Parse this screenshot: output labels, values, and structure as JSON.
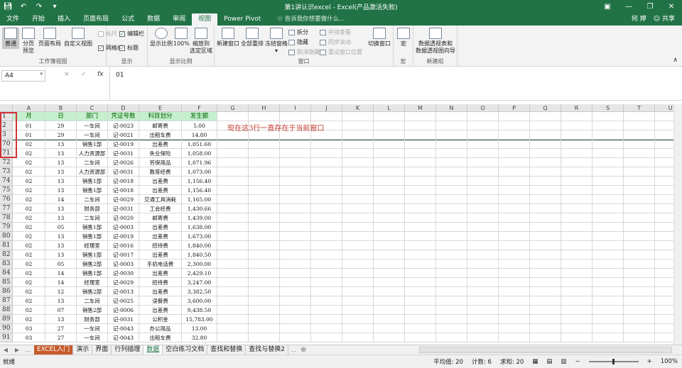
{
  "titlebar": {
    "title": "第1讲认识excel - Excel(产品激活失败)",
    "user": "何 婷",
    "share": "共享"
  },
  "tabs": [
    "文件",
    "开始",
    "插入",
    "页面布局",
    "公式",
    "数据",
    "审阅",
    "视图",
    "Power Pivot"
  ],
  "active_tab_index": 7,
  "search_placeholder": "告诉我你想要做什么...",
  "ribbon": {
    "groups": {
      "workbook_views": "工作簿视图",
      "show": "显示",
      "zoom": "显示比例",
      "window": "窗口",
      "macros": "宏",
      "new_group": "新建组"
    },
    "normal": "普通",
    "page_break": "分页\n预览",
    "page_layout": "页面布局",
    "custom_view": "自定义视图",
    "ruler": "标尺",
    "gridlines": "网格线",
    "formula_bar": "编辑栏",
    "headings": "标题",
    "zoom": "显示比例",
    "zoom100": "100%",
    "zoom_selection": "缩放到\n选定区域",
    "new_window": "新建窗口",
    "arrange_all": "全部重排",
    "freeze_panes": "冻结窗格",
    "split": "拆分",
    "hide": "隐藏",
    "unhide": "取消隐藏",
    "side_by_side": "并排查看",
    "sync_scroll": "同步滚动",
    "reset_position": "重设窗口位置",
    "switch_windows": "切换窗口",
    "macros": "宏",
    "pivot_wizard": "数据透视表和\n数据透视图向导"
  },
  "formula": {
    "name_box": "A4",
    "cancel_icon": "×",
    "enter_icon": "✓",
    "fx": "fx",
    "value": "01"
  },
  "columns": [
    "A",
    "B",
    "C",
    "D",
    "E",
    "F",
    "G",
    "H",
    "I",
    "J",
    "K",
    "L",
    "M",
    "N",
    "O",
    "P",
    "Q",
    "R",
    "S",
    "T",
    "U"
  ],
  "header_row": {
    "row": "1",
    "cells": [
      "月",
      "日",
      "部门",
      "凭证号数",
      "科目划分",
      "发生额"
    ]
  },
  "rows": [
    {
      "row": "2",
      "cells": [
        "01",
        "29",
        "一车间",
        "记-0023",
        "邮寄费",
        "5.00"
      ]
    },
    {
      "row": "3",
      "cells": [
        "01",
        "29",
        "一车间",
        "记-0021",
        "出租车费",
        "14.80"
      ]
    },
    {
      "row": "70",
      "cells": [
        "02",
        "13",
        "销售1部",
        "记-0019",
        "出差费",
        "1,051.60"
      ]
    },
    {
      "row": "71",
      "cells": [
        "02",
        "13",
        "人力资源部",
        "记-0031",
        "失业保险",
        "1,058.00"
      ]
    },
    {
      "row": "72",
      "cells": [
        "02",
        "13",
        "二车间",
        "记-0026",
        "劳保用品",
        "1,071.96"
      ]
    },
    {
      "row": "73",
      "cells": [
        "02",
        "13",
        "人力资源部",
        "记-0031",
        "教育经费",
        "1,073.00"
      ]
    },
    {
      "row": "74",
      "cells": [
        "02",
        "13",
        "销售1部",
        "记-0018",
        "出差费",
        "1,156.40"
      ]
    },
    {
      "row": "75",
      "cells": [
        "02",
        "13",
        "销售1部",
        "记-0018",
        "出差费",
        "1,156.40"
      ]
    },
    {
      "row": "76",
      "cells": [
        "02",
        "14",
        "二车间",
        "记-0029",
        "交通工具消耗",
        "1,165.00"
      ]
    },
    {
      "row": "77",
      "cells": [
        "02",
        "13",
        "财务部",
        "记-0031",
        "工会经费",
        "1,430.66"
      ]
    },
    {
      "row": "78",
      "cells": [
        "02",
        "13",
        "二车间",
        "记-0020",
        "邮寄费",
        "1,439.00"
      ]
    },
    {
      "row": "79",
      "cells": [
        "02",
        "05",
        "销售1部",
        "记-0003",
        "出差费",
        "1,638.00"
      ]
    },
    {
      "row": "80",
      "cells": [
        "02",
        "13",
        "销售1部",
        "记-0019",
        "出差费",
        "1,673.00"
      ]
    },
    {
      "row": "81",
      "cells": [
        "02",
        "13",
        "经理室",
        "记-0016",
        "招待费",
        "1,840.00"
      ]
    },
    {
      "row": "82",
      "cells": [
        "02",
        "13",
        "销售1部",
        "记-0017",
        "出差费",
        "1,840.50"
      ]
    },
    {
      "row": "83",
      "cells": [
        "02",
        "05",
        "销售2部",
        "记-0003",
        "手机电话费",
        "2,300.00"
      ]
    },
    {
      "row": "84",
      "cells": [
        "02",
        "14",
        "销售1部",
        "记-0030",
        "出差费",
        "2,429.10"
      ]
    },
    {
      "row": "85",
      "cells": [
        "02",
        "14",
        "经理室",
        "记-0029",
        "招待费",
        "3,247.00"
      ]
    },
    {
      "row": "86",
      "cells": [
        "02",
        "12",
        "销售2部",
        "记-0013",
        "出差费",
        "3,382.50"
      ]
    },
    {
      "row": "87",
      "cells": [
        "02",
        "13",
        "二车间",
        "记-0025",
        "误餐费",
        "3,600.00"
      ]
    },
    {
      "row": "88",
      "cells": [
        "02",
        "07",
        "销售2部",
        "记-0006",
        "出差费",
        "9,438.50"
      ]
    },
    {
      "row": "89",
      "cells": [
        "02",
        "13",
        "财务部",
        "记-0031",
        "公积金",
        "15,783.00"
      ]
    },
    {
      "row": "90",
      "cells": [
        "03",
        "27",
        "一车间",
        "记-0043",
        "办公用品",
        "13.00"
      ]
    },
    {
      "row": "91",
      "cells": [
        "03",
        "27",
        "一车间",
        "记-0043",
        "出租车费",
        "32.80"
      ]
    }
  ],
  "annotation": "现在这3行一直存在于当前窗口",
  "sheet_tabs": [
    "EXCEL入门",
    "演示",
    "界面",
    "行列插理",
    "数据",
    "空白练习文档",
    "查找和替换",
    "查找与替换2"
  ],
  "active_sheet_index": 4,
  "status": {
    "ready": "就绪",
    "average": "平均值: 20",
    "count": "计数: 6",
    "sum": "求和: 20",
    "zoom": "100%"
  }
}
